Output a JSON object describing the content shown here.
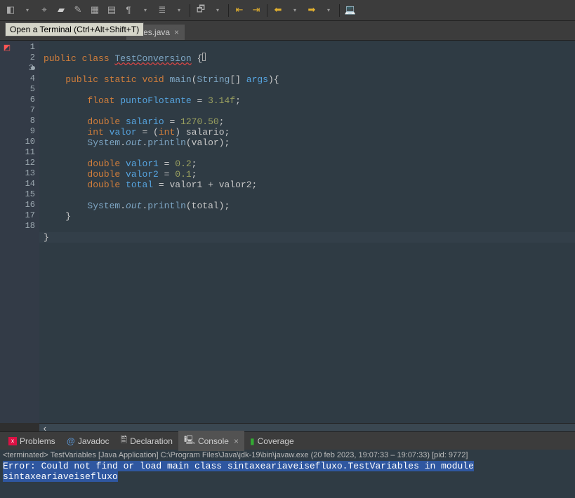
{
  "toolbar": {
    "tooltip": "Open a Terminal (Ctrl+Alt+Shift+T)"
  },
  "tabs": {
    "editor_tab": "ables.java",
    "close_glyph": "×"
  },
  "gutter": {
    "lines": [
      "1",
      "2",
      "3",
      "4",
      "5",
      "6",
      "7",
      "8",
      "9",
      "10",
      "11",
      "12",
      "13",
      "14",
      "15",
      "16",
      "17",
      "18"
    ]
  },
  "code": {
    "kw_public": "public",
    "kw_class": "class",
    "cls_name": "TestConversion",
    "kw_static": "static",
    "kw_void": "void",
    "m_main": "main",
    "t_string": "String",
    "arr": "[]",
    "p_args": "args",
    "ob": "{",
    "cb": "}",
    "kw_float": "float",
    "v_pf": "puntoFlotante",
    "n_314f": "3.14f",
    "kw_double": "double",
    "v_sal": "salario",
    "n_127050": "1270.50",
    "kw_int": "int",
    "v_valor": "valor",
    "cast_int": "int",
    "sys": "System",
    "dot": ".",
    "out": "out",
    "println": "println",
    "v_valor1": "valor1",
    "n_02": "0.2",
    "v_valor2": "valor2",
    "n_01": "0.1",
    "v_total": "total",
    "plus": " + "
  },
  "bottom_tabs": {
    "problems": "Problems",
    "javadoc": "Javadoc",
    "declaration": "Declaration",
    "console": "Console",
    "coverage": "Coverage"
  },
  "console": {
    "status": "<terminated> TestVariables [Java Application] C:\\Program Files\\Java\\jdk-19\\bin\\javaw.exe  (20 feb 2023, 19:07:33 – 19:07:33) [pid: 9772]",
    "error": "Error: Could not find or load main class sintaxeariaveisefluxo.TestVariables in module sintaxeariaveisefluxo"
  }
}
